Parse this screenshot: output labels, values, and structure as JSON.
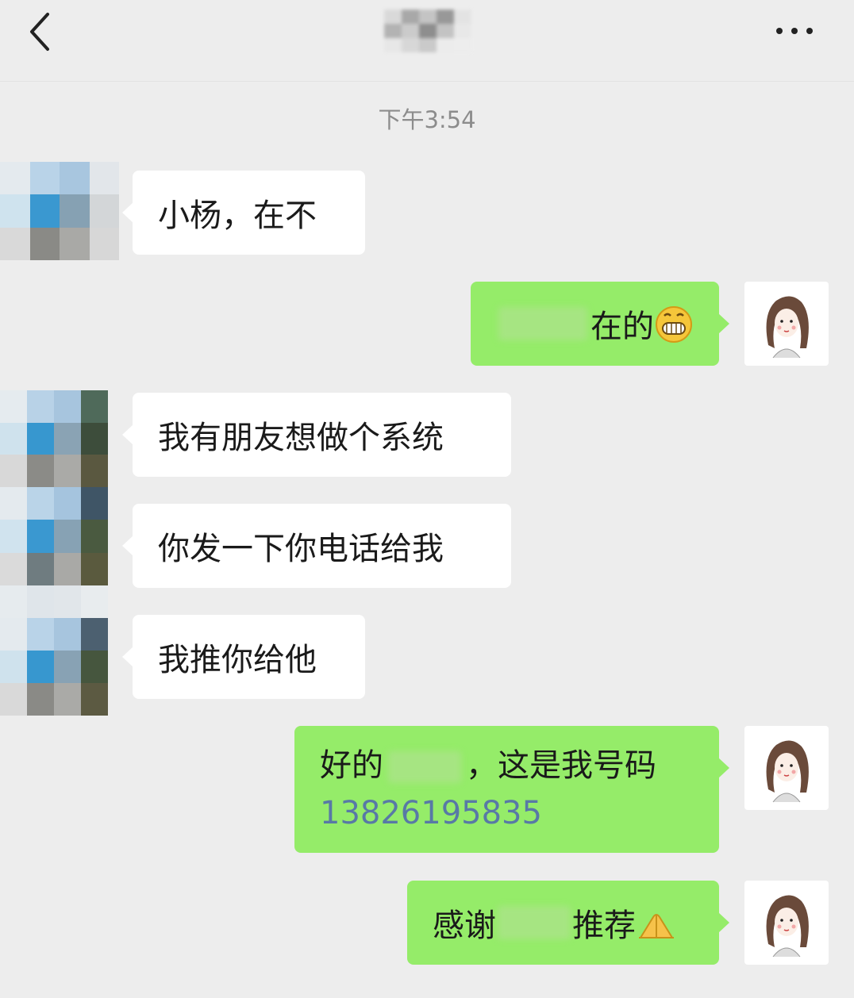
{
  "header": {
    "back_icon": "chevron-left-icon",
    "title": "",
    "more_icon": "more-dots-icon"
  },
  "timestamp": "下午3:54",
  "messages": [
    {
      "side": "in",
      "text": "小杨，在不"
    },
    {
      "side": "out",
      "text": "在的",
      "emoji": "grin-emoji"
    },
    {
      "side": "in",
      "text": "我有朋友想做个系统"
    },
    {
      "side": "in",
      "text": "你发一下你电话给我"
    },
    {
      "side": "in",
      "text": "我推你给他"
    },
    {
      "side": "out",
      "prefix": "好的",
      "suffix": "，这是我号码",
      "phone": "13826195835"
    },
    {
      "side": "out",
      "prefix": "感谢",
      "suffix": "推荐",
      "emoji": "thanks-hands-emoji"
    }
  ],
  "colors": {
    "background": "#ededed",
    "incoming_bubble": "#ffffff",
    "outgoing_bubble": "#95ec69",
    "link": "#5879a6"
  }
}
